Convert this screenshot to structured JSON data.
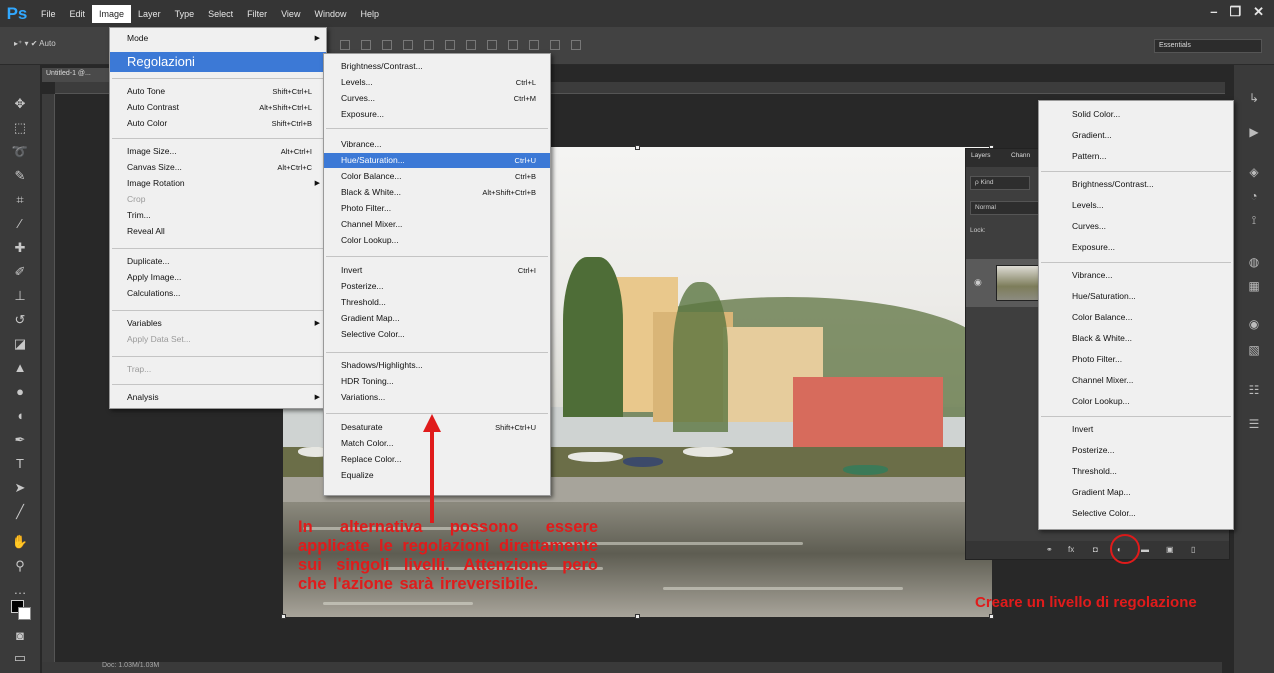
{
  "app": {
    "logo": "Ps",
    "menu": [
      "File",
      "Edit",
      "Image",
      "Layer",
      "Type",
      "Select",
      "Filter",
      "View",
      "Window",
      "Help"
    ],
    "active_menu": "Image",
    "window_controls": [
      "–",
      "❐",
      "✕"
    ],
    "workspace": "Essentials",
    "options_left": "▸⁺ ▾  ✔ Auto"
  },
  "document": {
    "tab": "Untitled-1 @...",
    "status": "Doc: 1.03M/1.03M"
  },
  "image_menu": {
    "items": [
      {
        "label": "Mode",
        "submenu": true
      },
      {
        "label": "Regolazioni",
        "big": true,
        "highlighted": true
      },
      {
        "label": "Auto Tone",
        "shortcut": "Shift+Ctrl+L"
      },
      {
        "label": "Auto Contrast",
        "shortcut": "Alt+Shift+Ctrl+L"
      },
      {
        "label": "Auto Color",
        "shortcut": "Shift+Ctrl+B"
      },
      {
        "label": "Image Size...",
        "shortcut": "Alt+Ctrl+I"
      },
      {
        "label": "Canvas Size...",
        "shortcut": "Alt+Ctrl+C"
      },
      {
        "label": "Image Rotation",
        "submenu": true
      },
      {
        "label": "Crop",
        "disabled": true
      },
      {
        "label": "Trim..."
      },
      {
        "label": "Reveal All"
      },
      {
        "label": "Duplicate..."
      },
      {
        "label": "Apply Image..."
      },
      {
        "label": "Calculations..."
      },
      {
        "label": "Variables",
        "submenu": true
      },
      {
        "label": "Apply Data Set...",
        "disabled": true
      },
      {
        "label": "Trap...",
        "disabled": true
      },
      {
        "label": "Analysis",
        "submenu": true
      }
    ]
  },
  "adjust_menu": {
    "items": [
      {
        "label": "Brightness/Contrast..."
      },
      {
        "label": "Levels...",
        "shortcut": "Ctrl+L"
      },
      {
        "label": "Curves...",
        "shortcut": "Ctrl+M"
      },
      {
        "label": "Exposure..."
      },
      {
        "label": "Vibrance..."
      },
      {
        "label": "Hue/Saturation...",
        "shortcut": "Ctrl+U",
        "highlighted": true
      },
      {
        "label": "Color Balance...",
        "shortcut": "Ctrl+B"
      },
      {
        "label": "Black & White...",
        "shortcut": "Alt+Shift+Ctrl+B"
      },
      {
        "label": "Photo Filter..."
      },
      {
        "label": "Channel Mixer..."
      },
      {
        "label": "Color Lookup..."
      },
      {
        "label": "Invert",
        "shortcut": "Ctrl+I"
      },
      {
        "label": "Posterize..."
      },
      {
        "label": "Threshold..."
      },
      {
        "label": "Gradient Map..."
      },
      {
        "label": "Selective Color..."
      },
      {
        "label": "Shadows/Highlights..."
      },
      {
        "label": "HDR Toning..."
      },
      {
        "label": "Variations..."
      },
      {
        "label": "Desaturate",
        "shortcut": "Shift+Ctrl+U"
      },
      {
        "label": "Match Color..."
      },
      {
        "label": "Replace Color..."
      },
      {
        "label": "Equalize"
      }
    ]
  },
  "adj_layer_menu": {
    "items": [
      "Solid Color...",
      "Gradient...",
      "Pattern...",
      "Brightness/Contrast...",
      "Levels...",
      "Curves...",
      "Exposure...",
      "Vibrance...",
      "Hue/Saturation...",
      "Color Balance...",
      "Black & White...",
      "Photo Filter...",
      "Channel Mixer...",
      "Color Lookup...",
      "Invert",
      "Posterize...",
      "Threshold...",
      "Gradient Map...",
      "Selective Color..."
    ]
  },
  "layers_panel": {
    "tabs": [
      "Layers",
      "Chann"
    ],
    "kind": "ρ Kind",
    "blend": "Normal",
    "lock": "Lock:"
  },
  "annotations": {
    "left": "In alternativa possono essere applicate le regolazioni direttamente sui singoli livelli. Attenzione però che l'azione sarà irreversibile.",
    "right": "Creare un livello di regolazione"
  },
  "colors": {
    "accent": "#3c79d6",
    "annotation": "#e01b1b",
    "ui_bg": "#282828"
  }
}
